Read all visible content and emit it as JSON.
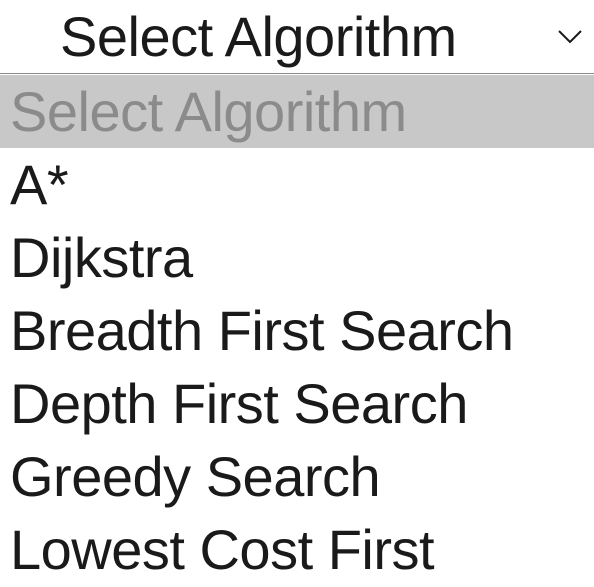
{
  "select": {
    "selected_label": "Select Algorithm",
    "chevron_icon": "chevron-down-icon",
    "options": [
      {
        "label": "Select Algorithm",
        "highlighted": true
      },
      {
        "label": "A*"
      },
      {
        "label": "Dijkstra"
      },
      {
        "label": "Breadth First Search"
      },
      {
        "label": "Depth First Search"
      },
      {
        "label": "Greedy Search"
      },
      {
        "label": "Lowest Cost First"
      }
    ]
  },
  "colors": {
    "highlight_bg": "#c8c8c8",
    "placeholder_text": "#8b8b8b",
    "text": "#1a1a1a"
  }
}
